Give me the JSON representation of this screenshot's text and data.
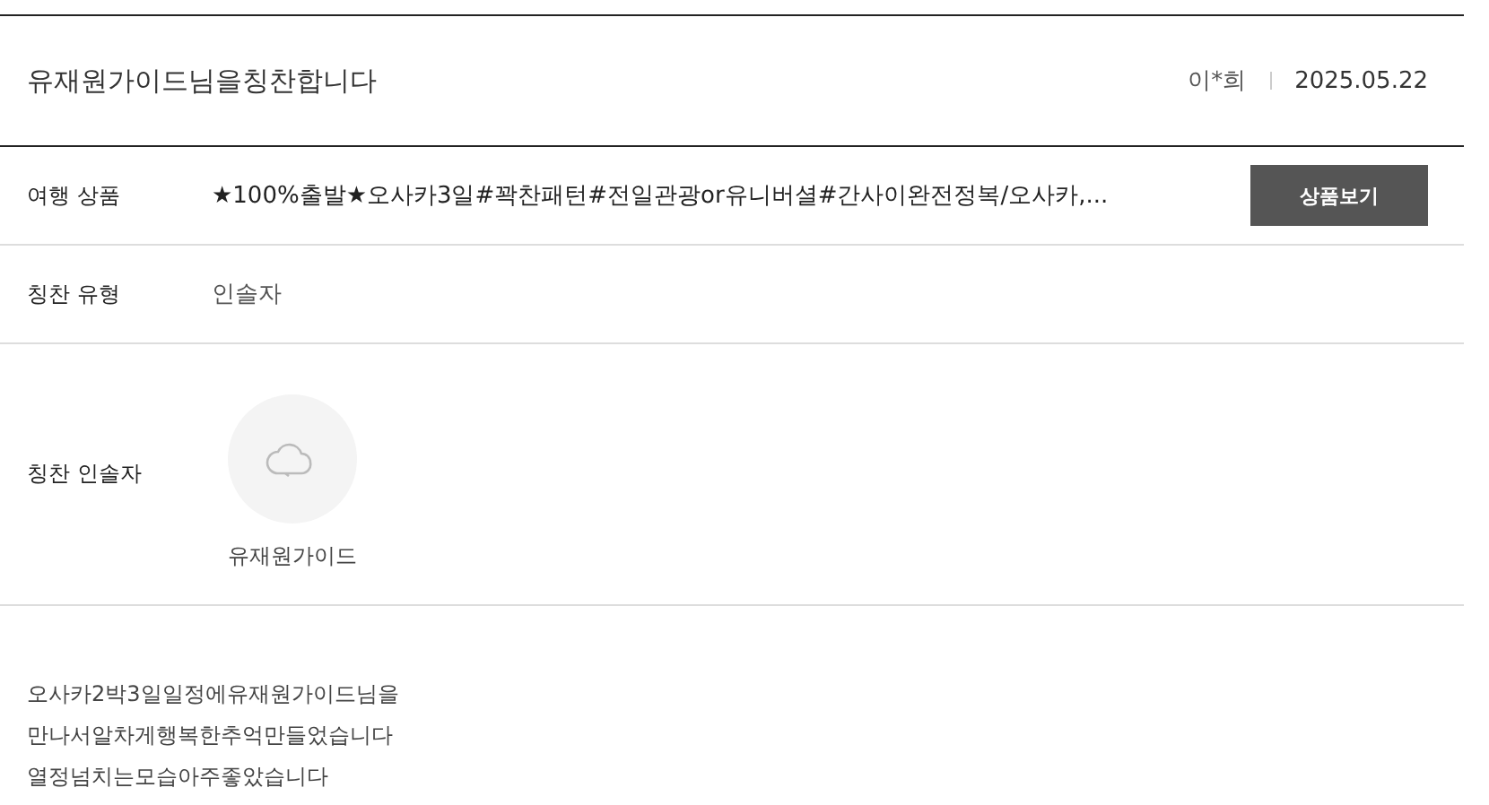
{
  "header": {
    "title": "유재원가이드님을칭찬합니다",
    "author": "이*희",
    "date": "2025.05.22"
  },
  "rows": [
    {
      "kind": "product",
      "label": "여행 상품",
      "value": "★100%출발★오사카3일#꽉찬패턴#전일관광or유니버셜#간사이완전정복/오사카,...",
      "button": "상품보기"
    },
    {
      "kind": "text",
      "label": "칭찬 유형",
      "value": "인솔자"
    },
    {
      "kind": "guide",
      "label": "칭찬 인솔자",
      "value": "유재원가이드"
    }
  ],
  "body": [
    "오사카2박3일일정에유재원가이드님을",
    "만나서알차게행복한추억만들었습니다",
    "열정넘치는모습아주좋았습니다"
  ]
}
